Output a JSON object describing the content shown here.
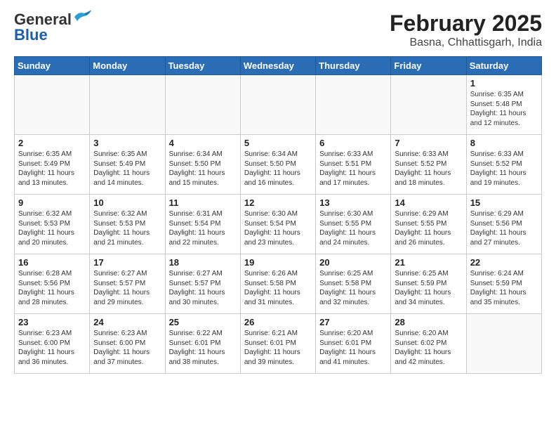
{
  "logo": {
    "general": "General",
    "blue": "Blue"
  },
  "title": {
    "month_year": "February 2025",
    "location": "Basna, Chhattisgarh, India"
  },
  "weekdays": [
    "Sunday",
    "Monday",
    "Tuesday",
    "Wednesday",
    "Thursday",
    "Friday",
    "Saturday"
  ],
  "weeks": [
    [
      {
        "day": "",
        "info": ""
      },
      {
        "day": "",
        "info": ""
      },
      {
        "day": "",
        "info": ""
      },
      {
        "day": "",
        "info": ""
      },
      {
        "day": "",
        "info": ""
      },
      {
        "day": "",
        "info": ""
      },
      {
        "day": "1",
        "info": "Sunrise: 6:35 AM\nSunset: 5:48 PM\nDaylight: 11 hours and 12 minutes."
      }
    ],
    [
      {
        "day": "2",
        "info": "Sunrise: 6:35 AM\nSunset: 5:49 PM\nDaylight: 11 hours and 13 minutes."
      },
      {
        "day": "3",
        "info": "Sunrise: 6:35 AM\nSunset: 5:49 PM\nDaylight: 11 hours and 14 minutes."
      },
      {
        "day": "4",
        "info": "Sunrise: 6:34 AM\nSunset: 5:50 PM\nDaylight: 11 hours and 15 minutes."
      },
      {
        "day": "5",
        "info": "Sunrise: 6:34 AM\nSunset: 5:50 PM\nDaylight: 11 hours and 16 minutes."
      },
      {
        "day": "6",
        "info": "Sunrise: 6:33 AM\nSunset: 5:51 PM\nDaylight: 11 hours and 17 minutes."
      },
      {
        "day": "7",
        "info": "Sunrise: 6:33 AM\nSunset: 5:52 PM\nDaylight: 11 hours and 18 minutes."
      },
      {
        "day": "8",
        "info": "Sunrise: 6:33 AM\nSunset: 5:52 PM\nDaylight: 11 hours and 19 minutes."
      }
    ],
    [
      {
        "day": "9",
        "info": "Sunrise: 6:32 AM\nSunset: 5:53 PM\nDaylight: 11 hours and 20 minutes."
      },
      {
        "day": "10",
        "info": "Sunrise: 6:32 AM\nSunset: 5:53 PM\nDaylight: 11 hours and 21 minutes."
      },
      {
        "day": "11",
        "info": "Sunrise: 6:31 AM\nSunset: 5:54 PM\nDaylight: 11 hours and 22 minutes."
      },
      {
        "day": "12",
        "info": "Sunrise: 6:30 AM\nSunset: 5:54 PM\nDaylight: 11 hours and 23 minutes."
      },
      {
        "day": "13",
        "info": "Sunrise: 6:30 AM\nSunset: 5:55 PM\nDaylight: 11 hours and 24 minutes."
      },
      {
        "day": "14",
        "info": "Sunrise: 6:29 AM\nSunset: 5:55 PM\nDaylight: 11 hours and 26 minutes."
      },
      {
        "day": "15",
        "info": "Sunrise: 6:29 AM\nSunset: 5:56 PM\nDaylight: 11 hours and 27 minutes."
      }
    ],
    [
      {
        "day": "16",
        "info": "Sunrise: 6:28 AM\nSunset: 5:56 PM\nDaylight: 11 hours and 28 minutes."
      },
      {
        "day": "17",
        "info": "Sunrise: 6:27 AM\nSunset: 5:57 PM\nDaylight: 11 hours and 29 minutes."
      },
      {
        "day": "18",
        "info": "Sunrise: 6:27 AM\nSunset: 5:57 PM\nDaylight: 11 hours and 30 minutes."
      },
      {
        "day": "19",
        "info": "Sunrise: 6:26 AM\nSunset: 5:58 PM\nDaylight: 11 hours and 31 minutes."
      },
      {
        "day": "20",
        "info": "Sunrise: 6:25 AM\nSunset: 5:58 PM\nDaylight: 11 hours and 32 minutes."
      },
      {
        "day": "21",
        "info": "Sunrise: 6:25 AM\nSunset: 5:59 PM\nDaylight: 11 hours and 34 minutes."
      },
      {
        "day": "22",
        "info": "Sunrise: 6:24 AM\nSunset: 5:59 PM\nDaylight: 11 hours and 35 minutes."
      }
    ],
    [
      {
        "day": "23",
        "info": "Sunrise: 6:23 AM\nSunset: 6:00 PM\nDaylight: 11 hours and 36 minutes."
      },
      {
        "day": "24",
        "info": "Sunrise: 6:23 AM\nSunset: 6:00 PM\nDaylight: 11 hours and 37 minutes."
      },
      {
        "day": "25",
        "info": "Sunrise: 6:22 AM\nSunset: 6:01 PM\nDaylight: 11 hours and 38 minutes."
      },
      {
        "day": "26",
        "info": "Sunrise: 6:21 AM\nSunset: 6:01 PM\nDaylight: 11 hours and 39 minutes."
      },
      {
        "day": "27",
        "info": "Sunrise: 6:20 AM\nSunset: 6:01 PM\nDaylight: 11 hours and 41 minutes."
      },
      {
        "day": "28",
        "info": "Sunrise: 6:20 AM\nSunset: 6:02 PM\nDaylight: 11 hours and 42 minutes."
      },
      {
        "day": "",
        "info": ""
      }
    ]
  ]
}
